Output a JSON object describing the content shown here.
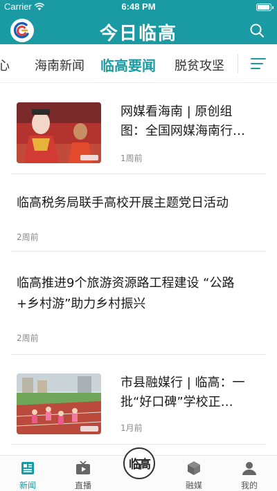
{
  "status_bar": {
    "carrier": "Carrier",
    "time": "6:48 PM"
  },
  "header": {
    "title": "今日临高",
    "logo_icon": "app-logo-icon",
    "search_icon": "search-icon"
  },
  "channels": {
    "items": [
      {
        "label": "心",
        "partial": true
      },
      {
        "label": "海南新闻"
      },
      {
        "label": "临高要闻",
        "active": true
      },
      {
        "label": "脱贫攻坚"
      }
    ],
    "menu_icon": "menu-lines-icon",
    "accent_color": "#1a9aa3"
  },
  "news": [
    {
      "title_line1": "网媒看海南 | 原创组",
      "title_line2": "图：全国网媒海南行…",
      "time": "1周前",
      "has_image": true
    },
    {
      "title_line1": "临高税务局联手高校开展主题党日活动",
      "time": "2周前",
      "has_image": false
    },
    {
      "title_line1": "临高推进9个旅游资源路工程建设 “公路",
      "title_line2": "+乡村游”助力乡村振兴",
      "time": "2周前",
      "has_image": false
    },
    {
      "title_line1": "市县融媒行 | 临高：一",
      "title_line2": "批“好口碑”学校正…",
      "time": "1月前",
      "has_image": true
    }
  ],
  "tabbar": {
    "items": [
      {
        "label": "新闻",
        "icon": "news-icon",
        "active": true
      },
      {
        "label": "直播",
        "icon": "tv-icon"
      },
      {
        "label": "融媒",
        "icon": "cube-icon"
      },
      {
        "label": "我的",
        "icon": "user-icon"
      }
    ],
    "center_label": "临高"
  },
  "colors": {
    "brand": "#1a9aa3",
    "text": "#1a1a1a",
    "muted": "#8a8a8a"
  }
}
